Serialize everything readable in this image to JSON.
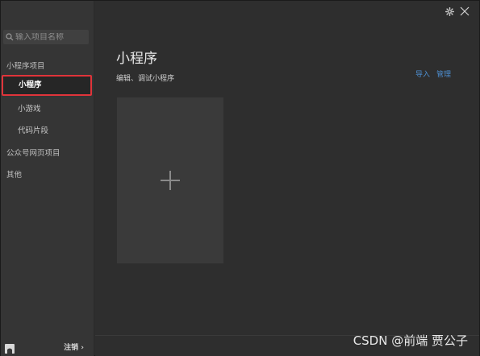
{
  "sidebar": {
    "search_placeholder": "输入项目名称",
    "section_miniprogram": "小程序项目",
    "items": [
      {
        "label": "小程序"
      },
      {
        "label": "小游戏"
      },
      {
        "label": "代码片段"
      }
    ],
    "section_web": "公众号网页项目",
    "section_other": "其他",
    "logout_label": "注销 ›"
  },
  "main": {
    "title": "小程序",
    "subtitle": "编辑、调试小程序",
    "import_label": "导入",
    "manage_label": "管理"
  },
  "watermark": "CSDN @前端 贾公子",
  "icons": {
    "search": "search-icon",
    "settings": "gear-icon",
    "close": "close-icon",
    "add": "plus-icon",
    "avatar": "avatar-icon"
  },
  "colors": {
    "selected_border": "#e0343a",
    "link": "#4d8fd1"
  }
}
